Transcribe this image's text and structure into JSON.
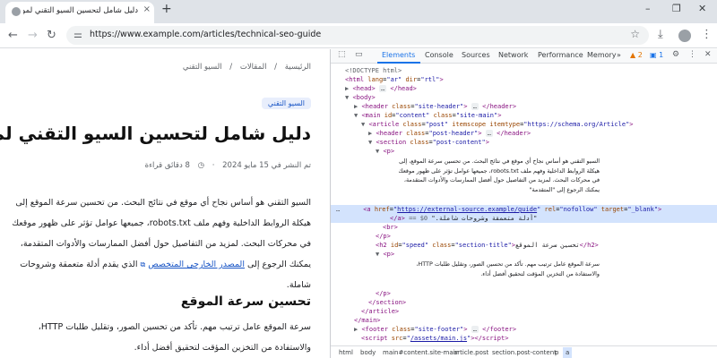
{
  "browser": {
    "tab_title": "دليل شامل لتحسين السيو التقني لموقعك",
    "tab_close": "×",
    "new_tab": "+",
    "url": "https://www.example.com/articles/technical-seo-guide",
    "window_buttons": [
      "–",
      "❐",
      "✕"
    ],
    "icons": [
      "back-icon",
      "forward-icon",
      "reload-icon",
      "tune-icon",
      "star-icon",
      "download-icon",
      "profile-icon",
      "menu-icon"
    ]
  },
  "article": {
    "breadcrumb": [
      "الرئيسية",
      "/",
      "المقالات",
      "/",
      "السيو التقني"
    ],
    "category": "السيو التقني",
    "title": "دليل شامل لتحسين السيو التقني لموقعك",
    "meta_date": "تم النشر في 15 مايو 2024",
    "meta_sep": "·",
    "meta_read": "8 دقائق قراءة",
    "p1_a": "السيو التقني هو أساس نجاح أي موقع في نتائج البحث. من تحسين سرعة الموقع إلى هيكلة الروابط الداخلية وفهم ملف robots.txt، جميعها عوامل تؤثر على ظهور موقعك في محركات البحث. لمزيد من التفاصيل حول أفضل الممارسات والأدوات المتقدمة، يمكنك الرجوع إلى",
    "p1_link": "المصدر الخارجي المتخصص",
    "p1_b": "الذي يقدم أدلة متعمقة وشروحات شاملة.",
    "h2": "تحسين سرعة الموقع",
    "p2": "سرعة الموقع عامل ترتيب مهم. تأكد من تحسين الصور، وتقليل طلبات HTTP، والاستفادة من التخزين المؤقت لتحقيق أفضل أداء."
  },
  "devtools": {
    "tabs": [
      "Elements",
      "Console",
      "Sources",
      "Network",
      "Performance",
      "Memory"
    ],
    "active_tab": "Elements",
    "more": "»",
    "warnings": "2",
    "info": "1",
    "dom": {
      "doctype": "<!DOCTYPE html>",
      "html_open": "<html",
      "html_lang": "ar",
      "html_dir": "rtl",
      "head": "<head>",
      "head_close": "</head>",
      "body": "<body>",
      "header_class": "site-header",
      "main_id": "content",
      "main_class": "site-main",
      "article_class": "post",
      "article_itemscope": "itemscope",
      "article_itemtype": "https://schema.org/Article",
      "post_header_class": "post-header",
      "section_class": "post-content",
      "p_text": "السيو التقني هو أساس نجاح أي موقع في نتائج البحث. من تحسين سرعة الموقع، إلى هيكلة الروابط الداخلية وفهم ملف robots.txt، جميعها عوامل تؤثر على ظهور موقعك في محركات البحث. لمزيد من التفاصيل حول أفضل الممارسات والأدوات المتقدمة، يمكنك الرجوع إلى \"المتقدمة\"",
      "a_href": "https://external-source.example/guide",
      "a_rel": "nofollow",
      "a_target": "_blank",
      "a_text": "\"أدلة متعمقة وشروحات شاملة.\"",
      "a_marker": "== $0",
      "br": "<br>",
      "p_close": "</p>",
      "h2_id": "speed",
      "h2_class": "section-title",
      "h2_text": "تحسين سرعة الموقع",
      "p2_text": "سرعة الموقع عامل ترتيب مهم. تأكد من تحسين الصور، وتقليل طلبات HTTP، والاستفادة من التخزين المؤقت لتحقيق أفضل أداء.",
      "section_close": "</section>",
      "article_close": "</article>",
      "main_close": "</main>",
      "footer_class": "site-footer",
      "script_src": "/assets/main.js",
      "body_close": "</body>",
      "html_close": "</html>"
    },
    "breadcrumbs": [
      "html",
      "body",
      "main#content.site-main",
      "article.post",
      "section.post-content",
      "p",
      "a"
    ]
  }
}
